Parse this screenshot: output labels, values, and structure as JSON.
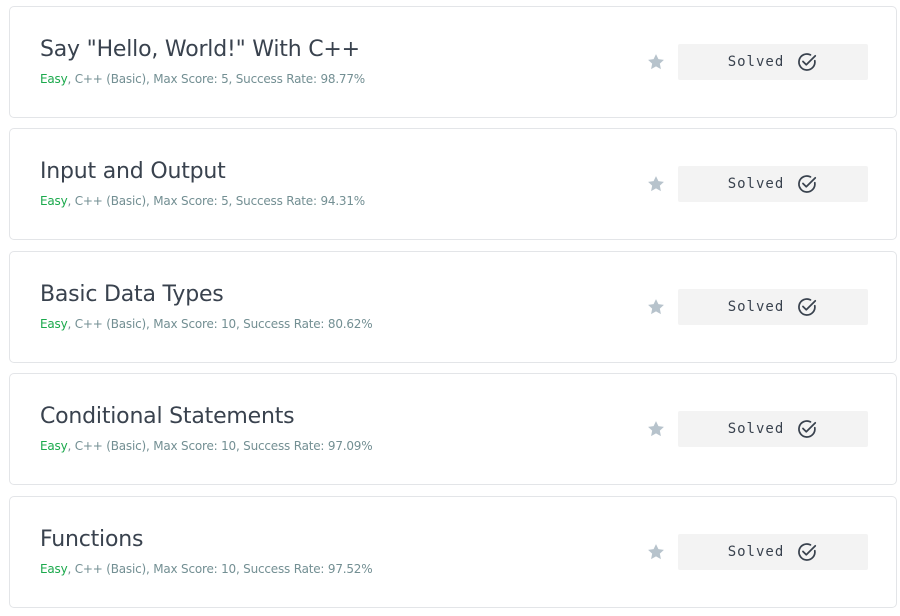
{
  "challenges": [
    {
      "title": "Say \"Hello, World!\" With C++",
      "difficulty": "Easy",
      "details": "C++ (Basic), Max Score: 5, Success Rate: 98.77%",
      "status": "Solved"
    },
    {
      "title": "Input and Output",
      "difficulty": "Easy",
      "details": "C++ (Basic), Max Score: 5, Success Rate: 94.31%",
      "status": "Solved"
    },
    {
      "title": "Basic Data Types",
      "difficulty": "Easy",
      "details": "C++ (Basic), Max Score: 10, Success Rate: 80.62%",
      "status": "Solved"
    },
    {
      "title": "Conditional Statements",
      "difficulty": "Easy",
      "details": "C++ (Basic), Max Score: 10, Success Rate: 97.09%",
      "status": "Solved"
    },
    {
      "title": "Functions",
      "difficulty": "Easy",
      "details": "C++ (Basic), Max Score: 10, Success Rate: 97.52%",
      "status": "Solved"
    }
  ],
  "colors": {
    "difficulty_easy": "#1ba94c",
    "star": "#b7c3cc",
    "button_bg": "#f3f3f3",
    "text": "#39424e"
  },
  "icons": {
    "bookmark": "star-icon",
    "solved": "check-circle-icon"
  }
}
